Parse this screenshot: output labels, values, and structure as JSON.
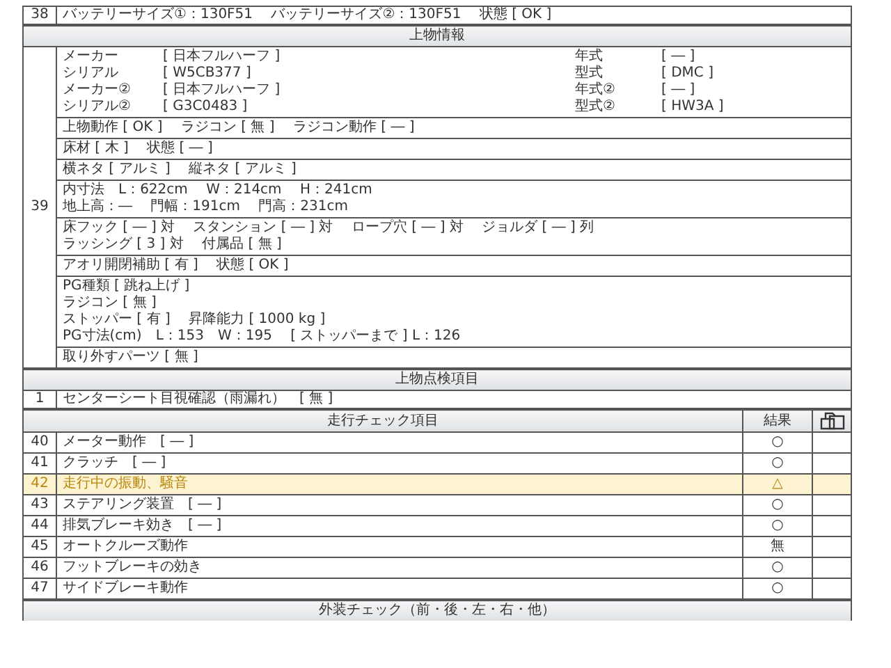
{
  "battery_row": {
    "no": "38",
    "text": "バッテリーサイズ①：130F51　 バッテリーサイズ②：130F51　 状態 [ OK ]"
  },
  "body_info": {
    "title": "上物情報",
    "no": "39",
    "maker_grid": [
      {
        "label": "メーカー",
        "value": "[ 日本フルハーフ ]",
        "label_2": "年式",
        "value_2": "[ ― ]"
      },
      {
        "label": "シリアル",
        "value": "[ W5CB377 ]",
        "label_2": "型式",
        "value_2": "[ DMC ]"
      },
      {
        "label": "メーカー②",
        "value": "[ 日本フルハーフ ]",
        "label_2": "年式②",
        "value_2": "[ ― ]"
      },
      {
        "label": "シリアル②",
        "value": "[ G3C0483 ]",
        "label_2": "型式②",
        "value_2": "[ HW3A ]"
      }
    ],
    "blocks": [
      [
        "上物動作 [ OK ]　 ラジコン [ 無 ]　 ラジコン動作 [ ― ]"
      ],
      [
        "床材 [ 木 ]　 状態 [ ― ]"
      ],
      [
        "横ネタ [ アルミ ]　 縦ネタ [ アルミ ]"
      ],
      [
        "内寸法　L：622cm　 W：214cm　 H：241cm",
        "地上高：―　 門幅：191cm　 門高：231cm"
      ],
      [
        "床フック [ ― ] 対　 スタンション [ ― ] 対　 ロープ穴 [ ― ] 対　 ジョルダ [ ― ] 列",
        "ラッシング [ 3 ] 対　 付属品 [ 無 ]"
      ],
      [
        "アオリ開閉補助 [ 有 ]　 状態 [ OK ]"
      ],
      [
        "PG種類 [ 跳ね上げ ]",
        "ラジコン [ 無 ]",
        "ストッパー [ 有 ]　 昇降能力 [ 1000 kg ]",
        "PG寸法(cm)　L：153　W：195　 [ ストッパーまで ] L：126"
      ],
      [
        "取り外すパーツ [ 無 ]"
      ]
    ]
  },
  "body_inspection": {
    "title": "上物点検項目",
    "rows": [
      {
        "no": "1",
        "text": "センターシート目視確認（雨漏れ）　[ 無 ]"
      }
    ]
  },
  "driving_check": {
    "title": "走行チェック項目",
    "result_heading": "結果",
    "rows": [
      {
        "no": "40",
        "item": "メーター動作　[ ― ]",
        "result": "○",
        "highlighted": false
      },
      {
        "no": "41",
        "item": "クラッチ　[ ― ]",
        "result": "○",
        "highlighted": false
      },
      {
        "no": "42",
        "item": "走行中の振動、騒音",
        "result": "△",
        "highlighted": true
      },
      {
        "no": "43",
        "item": "ステアリング装置　[ ― ]",
        "result": "○",
        "highlighted": false
      },
      {
        "no": "44",
        "item": "排気ブレーキ効き　[ ― ]",
        "result": "○",
        "highlighted": false
      },
      {
        "no": "45",
        "item": "オートクルーズ動作",
        "result": "無",
        "highlighted": false
      },
      {
        "no": "46",
        "item": "フットブレーキの効き",
        "result": "○",
        "highlighted": false
      },
      {
        "no": "47",
        "item": "サイドブレーキ動作",
        "result": "○",
        "highlighted": false
      }
    ]
  },
  "exterior_check": {
    "title": "外装チェック（前・後・左・右・他）"
  }
}
